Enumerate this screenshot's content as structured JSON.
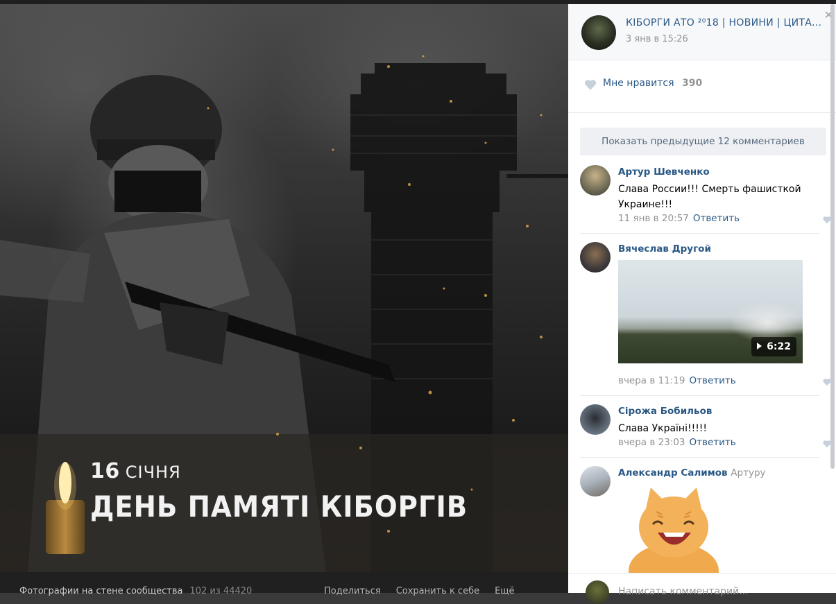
{
  "photo": {
    "caption_day": "16",
    "caption_month": "СІЧНЯ",
    "caption_title": "ДЕНЬ ПАМЯТІ КІБОРГІВ"
  },
  "photo_footer": {
    "album_label": "Фотографии на стене сообщества",
    "counter": "102 из 44420",
    "share": "Поделиться",
    "save": "Сохранить к себе",
    "more": "Ещё"
  },
  "group": {
    "name": "КІБОРГИ АТО ²⁰18 | НОВИНИ | ЦИТА...",
    "date": "3 янв в 15:26"
  },
  "likes": {
    "label": "Мне нравится",
    "count": "390"
  },
  "show_previous": "Показать предыдущие 12 комментариев",
  "comments": [
    {
      "author": "Артур Шевченко",
      "text": "Слава России!!! Смерть фашисткой Украине!!!",
      "date": "11 янв в 20:57",
      "reply": "Ответить"
    },
    {
      "author": "Вячеслав Другой",
      "video_duration": "6:22",
      "date": "вчера в 11:19",
      "reply": "Ответить"
    },
    {
      "author": "Сірожа Бобильов",
      "text": "Слава Україні!!!!!",
      "date": "вчера в 23:03",
      "reply": "Ответить"
    },
    {
      "author": "Александр Салимов",
      "reply_to": "Артуру"
    }
  ],
  "write_placeholder": "Написать комментарий...",
  "colors": {
    "link": "#2a5885",
    "muted": "#939393",
    "accent_like": "#c5d0db"
  }
}
